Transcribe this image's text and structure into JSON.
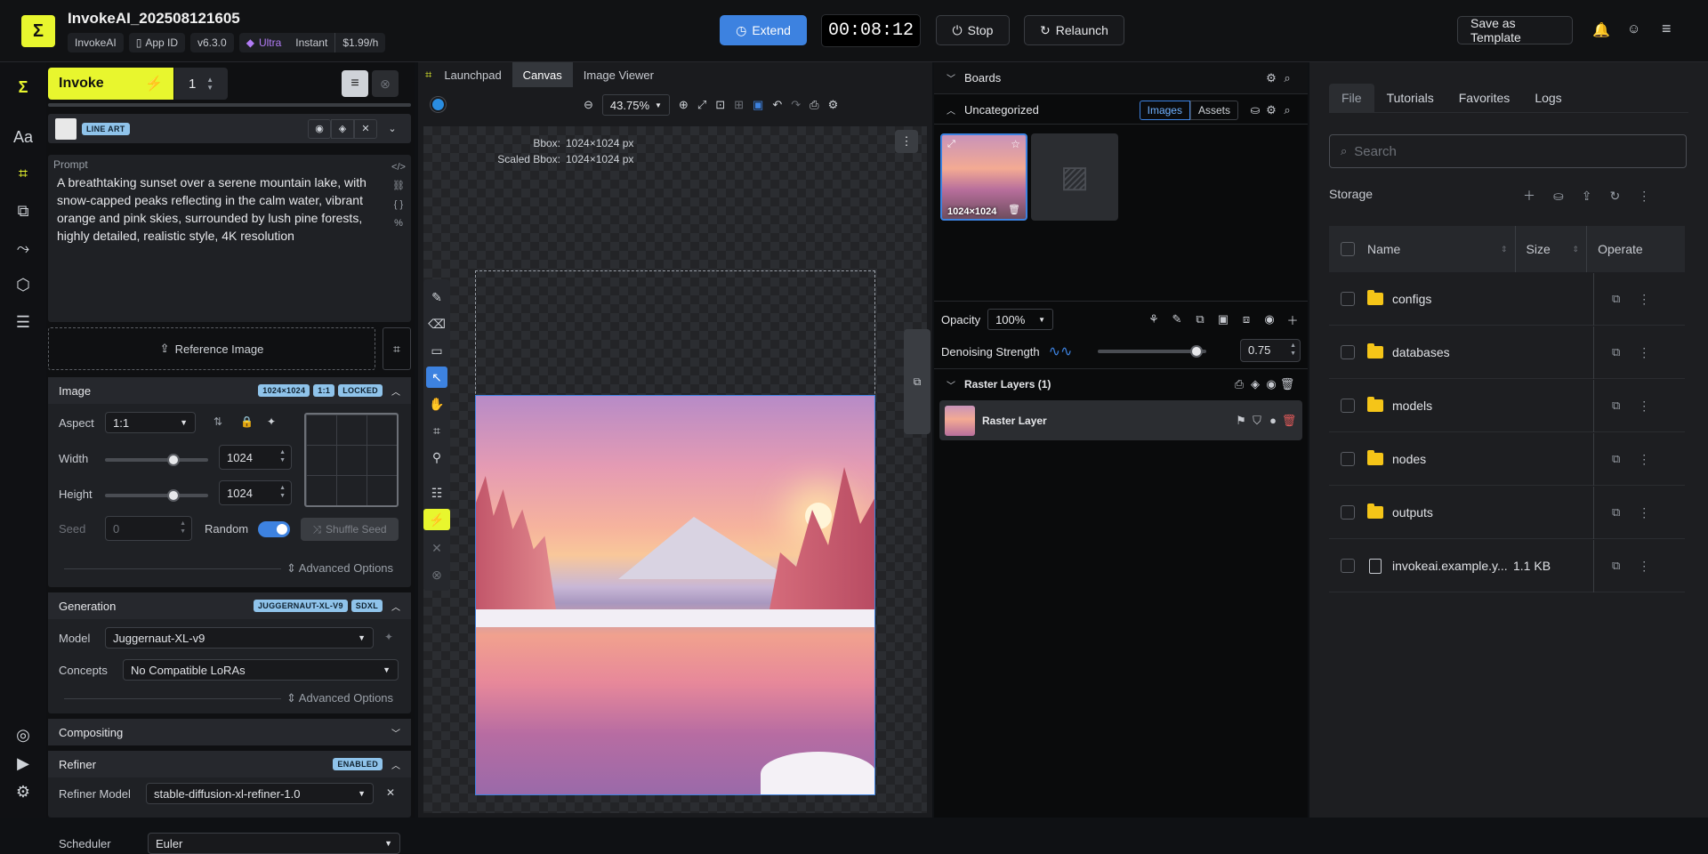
{
  "header": {
    "project_title": "InvokeAI_202508121605",
    "chips": {
      "app": "InvokeAI",
      "app_id": "App ID",
      "version": "v6.3.0",
      "tier": "Ultra",
      "mode": "Instant",
      "price": "$1.99/h"
    },
    "extend_label": "Extend",
    "timer": "00:08:12",
    "stop_label": "Stop",
    "relaunch_label": "Relaunch",
    "save_template_label": "Save as Template"
  },
  "left": {
    "invoke_label": "Invoke",
    "invoke_count": "1",
    "lineart_badge": "LINE ART",
    "prompt_label": "Prompt",
    "prompt_text": "A breathtaking sunset over a serene mountain lake, with snow-capped peaks reflecting in the calm water, vibrant orange and pink skies, surrounded by lush pine forests, highly detailed, realistic style, 4K resolution",
    "reference_image_label": "Reference Image",
    "image_section": {
      "title": "Image",
      "badges": [
        "1024×1024",
        "1:1",
        "LOCKED"
      ],
      "aspect_label": "Aspect",
      "aspect_value": "1:1",
      "width_label": "Width",
      "width_value": "1024",
      "width_level": 0.68,
      "height_label": "Height",
      "height_value": "1024",
      "height_level": 0.68,
      "seed_label": "Seed",
      "seed_value": "0",
      "random_label": "Random",
      "shuffle_label": "Shuffle Seed",
      "advanced_label": "Advanced Options"
    },
    "generation_section": {
      "title": "Generation",
      "badges": [
        "JUGGERNAUT-XL-V9",
        "SDXL"
      ],
      "model_label": "Model",
      "model_value": "Juggernaut-XL-v9",
      "concepts_label": "Concepts",
      "concepts_value": "No Compatible LoRAs",
      "advanced_label": "Advanced Options"
    },
    "compositing_title": "Compositing",
    "refiner_section": {
      "title": "Refiner",
      "badge": "ENABLED",
      "refiner_model_label": "Refiner Model",
      "refiner_model_value": "stable-diffusion-xl-refiner-1.0",
      "scheduler_label": "Scheduler",
      "scheduler_value": "Euler"
    }
  },
  "canvas": {
    "tabs": [
      "Launchpad",
      "Canvas",
      "Image Viewer"
    ],
    "zoom": "43.75%",
    "bbox_label": "Bbox:",
    "bbox_value": "1024×1024 px",
    "scaled_bbox_label": "Scaled Bbox:",
    "scaled_bbox_value": "1024×1024 px"
  },
  "boards": {
    "title": "Boards",
    "uncategorized": "Uncategorized",
    "images_tab": "Images",
    "assets_tab": "Assets",
    "thumb_label": "1024×1024",
    "opacity_label": "Opacity",
    "opacity_value": "100%",
    "denoise_label": "Denoising Strength",
    "denoise_value": "0.75",
    "denoise_level": 0.75,
    "raster_title": "Raster Layers (1)",
    "raster_layer_name": "Raster Layer"
  },
  "files": {
    "tabs": [
      "File",
      "Tutorials",
      "Favorites",
      "Logs"
    ],
    "search_placeholder": "Search",
    "storage_label": "Storage",
    "col_name": "Name",
    "col_size": "Size",
    "col_operate": "Operate",
    "rows": [
      {
        "name": "configs",
        "size": "",
        "type": "folder"
      },
      {
        "name": "databases",
        "size": "",
        "type": "folder"
      },
      {
        "name": "models",
        "size": "",
        "type": "folder"
      },
      {
        "name": "nodes",
        "size": "",
        "type": "folder"
      },
      {
        "name": "outputs",
        "size": "",
        "type": "folder"
      },
      {
        "name": "invokeai.example.y...",
        "size": "1.1 KB",
        "type": "file"
      }
    ]
  }
}
